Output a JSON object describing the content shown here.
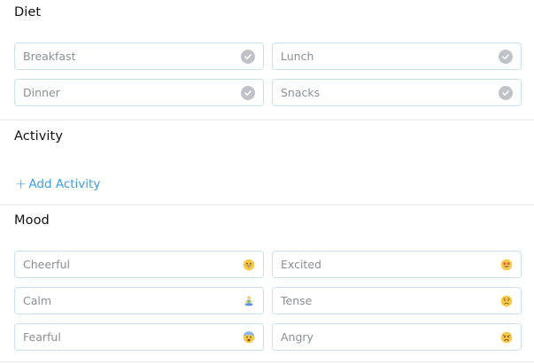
{
  "diet": {
    "title": "Diet",
    "items": [
      {
        "label": "Breakfast"
      },
      {
        "label": "Lunch"
      },
      {
        "label": "Dinner"
      },
      {
        "label": "Snacks"
      }
    ]
  },
  "activity": {
    "title": "Activity",
    "add_plus": "+",
    "add_label": "Add Activity"
  },
  "mood": {
    "title": "Mood",
    "items": [
      {
        "label": "Cheerful",
        "icon": "grinning-face-icon"
      },
      {
        "label": "Excited",
        "icon": "star-struck-face-icon"
      },
      {
        "label": "Calm",
        "icon": "meditating-person-icon"
      },
      {
        "label": "Tense",
        "icon": "worried-face-icon"
      },
      {
        "label": "Fearful",
        "icon": "fearful-face-icon"
      },
      {
        "label": "Angry",
        "icon": "angry-face-icon"
      }
    ]
  },
  "colors": {
    "accent": "#3d9be9",
    "tile_border": "#c9e1f5",
    "check_gray": "#bfc3c7",
    "label_gray": "#8a8f96"
  }
}
